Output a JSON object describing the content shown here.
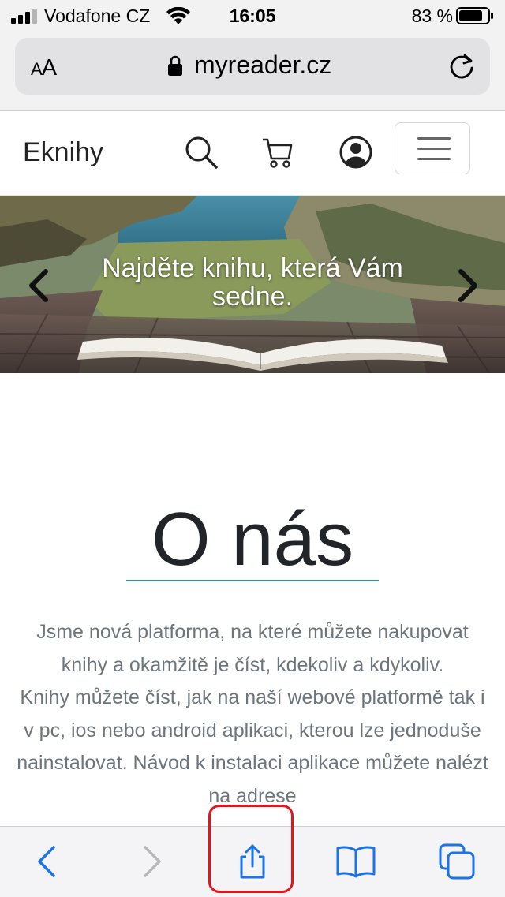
{
  "status_bar": {
    "carrier": "Vodafone CZ",
    "time": "16:05",
    "battery_percent": "83 %",
    "battery_level": 0.83
  },
  "address_bar": {
    "text_size_label": "AA",
    "url": "myreader.cz"
  },
  "site_nav": {
    "brand": "Eknihy"
  },
  "hero": {
    "caption": "Najděte knihu, která Vám sedne."
  },
  "about": {
    "title": "O nás",
    "paragraph_1": "Jsme nová platforma, na které můžete nakupovat knihy a okamžitě je číst, kdekoliv a kdykoliv.",
    "paragraph_2": "Knihy můžete číst, jak na naší webové platformě tak i v pc, ios nebo android aplikaci, kterou lze jednoduše nainstalovat. Návod k instalaci aplikace můžete nalézt na adrese"
  },
  "colors": {
    "accent": "#3b86c6",
    "toolbar_blue": "#1a73e8",
    "highlight": "#e0161b"
  },
  "icons": [
    "signal-icon",
    "wifi-icon",
    "battery-icon",
    "lock-icon",
    "reload-icon",
    "search-icon",
    "cart-icon",
    "user-icon",
    "menu-icon",
    "chevron-left-icon",
    "chevron-right-icon",
    "back-icon",
    "forward-icon",
    "share-icon",
    "bookmarks-icon",
    "tabs-icon"
  ]
}
